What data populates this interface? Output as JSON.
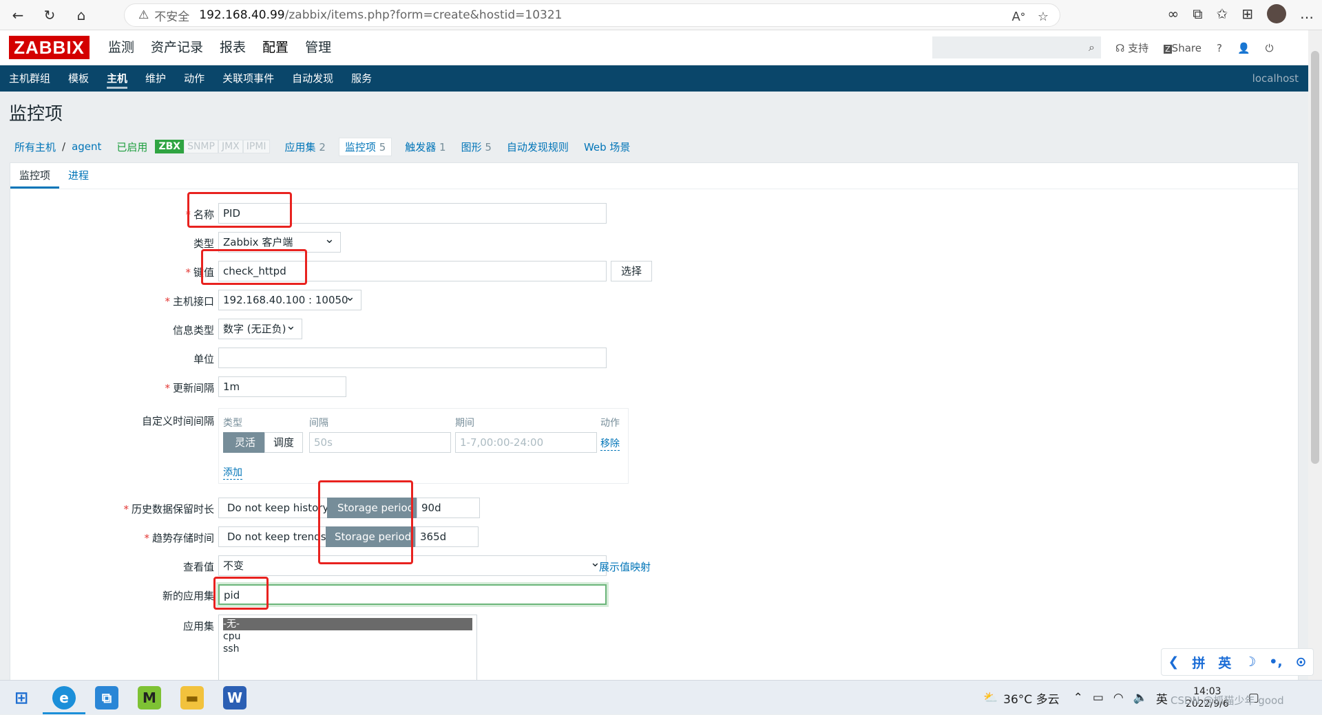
{
  "browser": {
    "insecure_label": "不安全",
    "url_host": "192.168.40.99",
    "url_path": "/zabbix/items.php?form=create&hostid=10321"
  },
  "header": {
    "logo": "ZABBIX",
    "menu": [
      "监测",
      "资产记录",
      "报表",
      "配置",
      "管理"
    ],
    "support": "支持",
    "share": "Share",
    "help": "?"
  },
  "submenu": {
    "items": [
      "主机群组",
      "模板",
      "主机",
      "维护",
      "动作",
      "关联项事件",
      "自动发现",
      "服务"
    ],
    "right": "localhost"
  },
  "page": {
    "title": "监控项"
  },
  "host_nav": {
    "all_hosts": "所有主机",
    "sep": "/",
    "host": "agent",
    "enabled": "已启用",
    "tags": [
      "ZBX",
      "SNMP",
      "JMX",
      "IPMI"
    ],
    "apps": "应用集",
    "apps_count": "2",
    "items": "监控项",
    "items_count": "5",
    "triggers": "触发器",
    "triggers_count": "1",
    "graphs": "图形",
    "graphs_count": "5",
    "discovery": "自动发现规则",
    "web": "Web 场景"
  },
  "tabs": [
    "监控项",
    "进程"
  ],
  "form": {
    "name_label": "名称",
    "name_value": "PID",
    "type_label": "类型",
    "type_value": "Zabbix 客户端",
    "key_label": "键值",
    "key_value": "check_httpd",
    "key_select": "选择",
    "interface_label": "主机接口",
    "interface_value": "192.168.40.100 : 10050",
    "info_type_label": "信息类型",
    "info_type_value": "数字 (无正负)",
    "unit_label": "单位",
    "interval_label": "更新间隔",
    "interval_value": "1m",
    "custom_label": "自定义时间间隔",
    "custom_cols": [
      "类型",
      "间隔",
      "期间",
      "动作"
    ],
    "custom_flexible": "灵活",
    "custom_scheduling": "调度",
    "custom_interval_placeholder": "50s",
    "custom_period_placeholder": "1-7,00:00-24:00",
    "custom_remove": "移除",
    "custom_add": "添加",
    "history_label": "历史数据保留时长",
    "history_no": "Do not keep history",
    "history_storage": "Storage period",
    "history_value": "90d",
    "trends_label": "趋势存储时间",
    "trends_no": "Do not keep trends",
    "trends_storage": "Storage period",
    "trends_value": "365d",
    "valuemap_label": "查看值",
    "valuemap_value": "不变",
    "valuemap_link": "展示值映射",
    "new_app_label": "新的应用集",
    "new_app_value": "pid",
    "apps_label": "应用集",
    "apps_list": [
      "-无-",
      "cpu",
      "ssh"
    ]
  },
  "ime": [
    "拼",
    "英"
  ],
  "taskbar": {
    "weather": "36°C 多云",
    "lang": "英",
    "time": "14:03",
    "date": "2022/9/6",
    "watermark": "CSDN @抓猫少年 good"
  }
}
